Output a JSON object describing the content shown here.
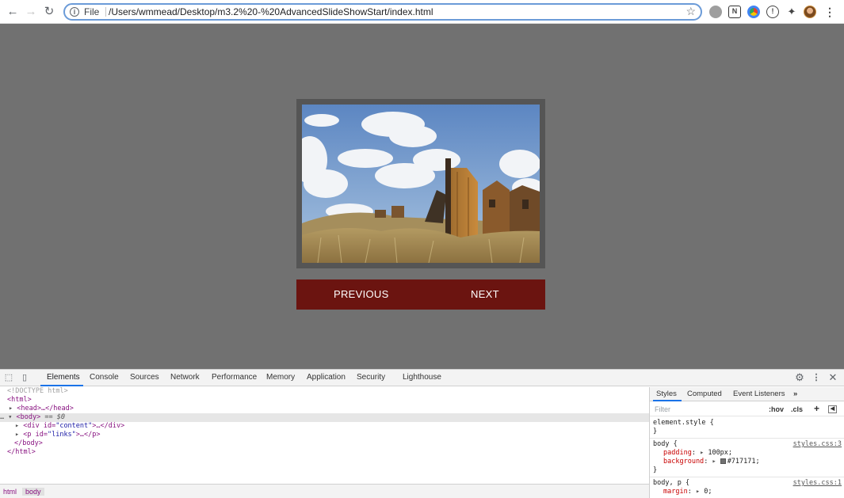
{
  "browser": {
    "url_scheme": "File",
    "url": "/Users/wmmead/Desktop/m3.2%20-%20AdvancedSlideShowStart/index.html"
  },
  "page": {
    "background_color": "#717171",
    "prev_label": "PREVIOUS",
    "next_label": "NEXT",
    "links_bg_color": "#6b1410"
  },
  "devtools": {
    "tabs": [
      "Elements",
      "Console",
      "Sources",
      "Network",
      "Performance",
      "Memory",
      "Application",
      "Security",
      "Lighthouse"
    ],
    "active_tab": "Elements",
    "dom": {
      "doctype": "<!DOCTYPE html>",
      "html_open": "<html>",
      "head": "<head>…</head>",
      "body_open": "<body>",
      "body_selected_marker": "== $0",
      "div_content_tag": "<div id=",
      "div_content_id": "\"content\"",
      "div_content_tail": ">…</div>",
      "p_links_tag": "<p id=",
      "p_links_id": "\"links\"",
      "p_links_tail": ">…</p>",
      "body_close": "</body>",
      "html_close": "</html>"
    },
    "breadcrumbs": [
      "html",
      "body"
    ],
    "styles_pane": {
      "tabs": [
        "Styles",
        "Computed",
        "Event Listeners"
      ],
      "filter_placeholder": "Filter",
      "hov_label": ":hov",
      "cls_label": ".cls",
      "element_style_open": "element.style {",
      "close_brace": "}",
      "rule1_selector": "body {",
      "rule1_source": "styles.css:3",
      "rule1_prop1_name": "padding",
      "rule1_prop1_value": "100px;",
      "rule1_prop2_name": "background",
      "rule1_prop2_value": "#717171;",
      "rule2_selector": "body, p {",
      "rule2_source": "styles.css:1",
      "rule2_prop1_name": "margin",
      "rule2_prop1_value": "0;"
    }
  }
}
